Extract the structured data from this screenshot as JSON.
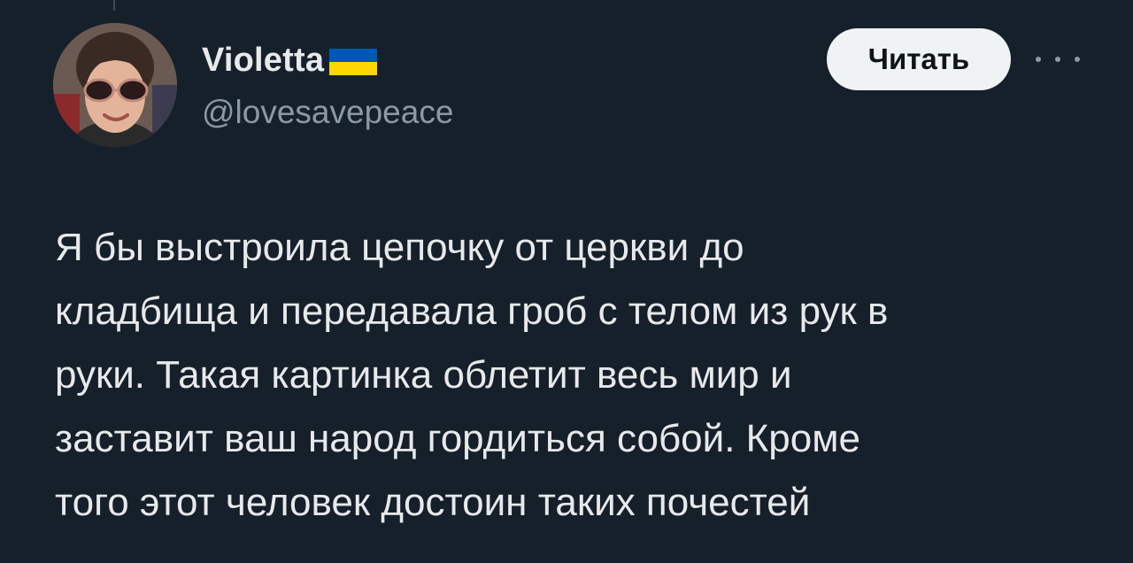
{
  "author": {
    "display_name": "Violetta",
    "flag_icon": "ukraine-flag-icon",
    "handle": "@lovesavepeace",
    "avatar_icon": "avatar-photo"
  },
  "actions": {
    "follow_label": "Читать",
    "more_icon": "more-options-icon"
  },
  "tweet": {
    "lines": [
      "Я бы выстроила цепочку от церкви до",
      "кладбища и передавала гроб с телом из рук в",
      "руки. Такая картинка облетит весь мир и",
      "заставит ваш народ гордиться собой. Кроме",
      "того этот человек достоин таких почестей"
    ]
  },
  "colors": {
    "background": "#16202b",
    "text_primary": "#e7e9ea",
    "text_secondary": "#8b98a5",
    "button_bg": "#eff3f4",
    "flag_blue": "#0057b7",
    "flag_yellow": "#ffd700"
  }
}
